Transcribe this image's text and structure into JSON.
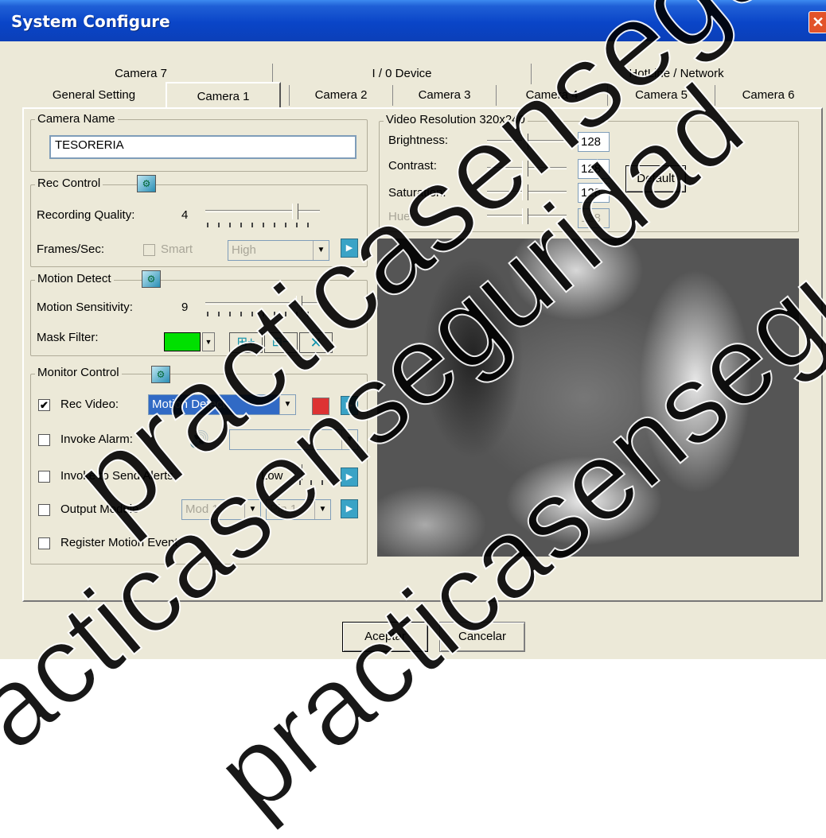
{
  "window": {
    "title": "System Configure",
    "close_glyph": "✕"
  },
  "tabs": {
    "back_row": [
      "Camera 7",
      "I / 0 Device",
      "HotLine / Network"
    ],
    "front_row": [
      "General Setting",
      "Camera 1",
      "Camera 2",
      "Camera 3",
      "Camera 4",
      "Camera 5",
      "Camera 6"
    ],
    "selected": "Camera 1"
  },
  "camera_name": {
    "label": "Camera Name",
    "value": "TESORERIA"
  },
  "rec_control": {
    "label": "Rec Control",
    "quality_label": "Recording Quality:",
    "quality_value": "4",
    "quality_level": 0.55,
    "fps_label": "Frames/Sec:",
    "smart_label": "Smart",
    "fps_option": "High"
  },
  "motion_detect": {
    "label": "Motion Detect",
    "sensitivity_label": "Motion Sensitivity:",
    "sensitivity_value": "9",
    "sensitivity_level": 0.78,
    "mask_label": "Mask Filter:",
    "mask_color": "#00e000"
  },
  "monitor_control": {
    "label": "Monitor Control",
    "rec_video_label": "Rec Video:",
    "rec_video_checked": true,
    "rec_video_option": "Motion Detect",
    "invoke_alarm_label": "Invoke Alarm:",
    "invoke_alerts_label": "Invoke to Send Alerts",
    "alerts_level_label": "Low",
    "output_module_label": "Output Module",
    "output_module_option": "Mod 1",
    "output_pin_option": "Pin 1",
    "register_label": "Register Motion Event"
  },
  "video": {
    "resolution_label": "Video Resolution",
    "resolution_value": "320x240",
    "brightness_label": "Brightness:",
    "brightness_value": "128",
    "contrast_label": "Contrast:",
    "contrast_value": "128",
    "saturation_label": "Saturation:",
    "saturation_value": "128",
    "hue_label": "Hue:",
    "hue_value": "128",
    "default_button": "Default"
  },
  "footer": {
    "accept_button": "Aceptar",
    "cancel_button": "Cancelar"
  },
  "watermark": {
    "text_a": "practicasenseguridad.co",
    "text_b": "practicasenseguridad",
    "text_c": "practicasenseguridad"
  },
  "icons": {
    "checkmark": "✔",
    "play": "▶",
    "dropdown": "▼",
    "speaker": "🔊"
  }
}
